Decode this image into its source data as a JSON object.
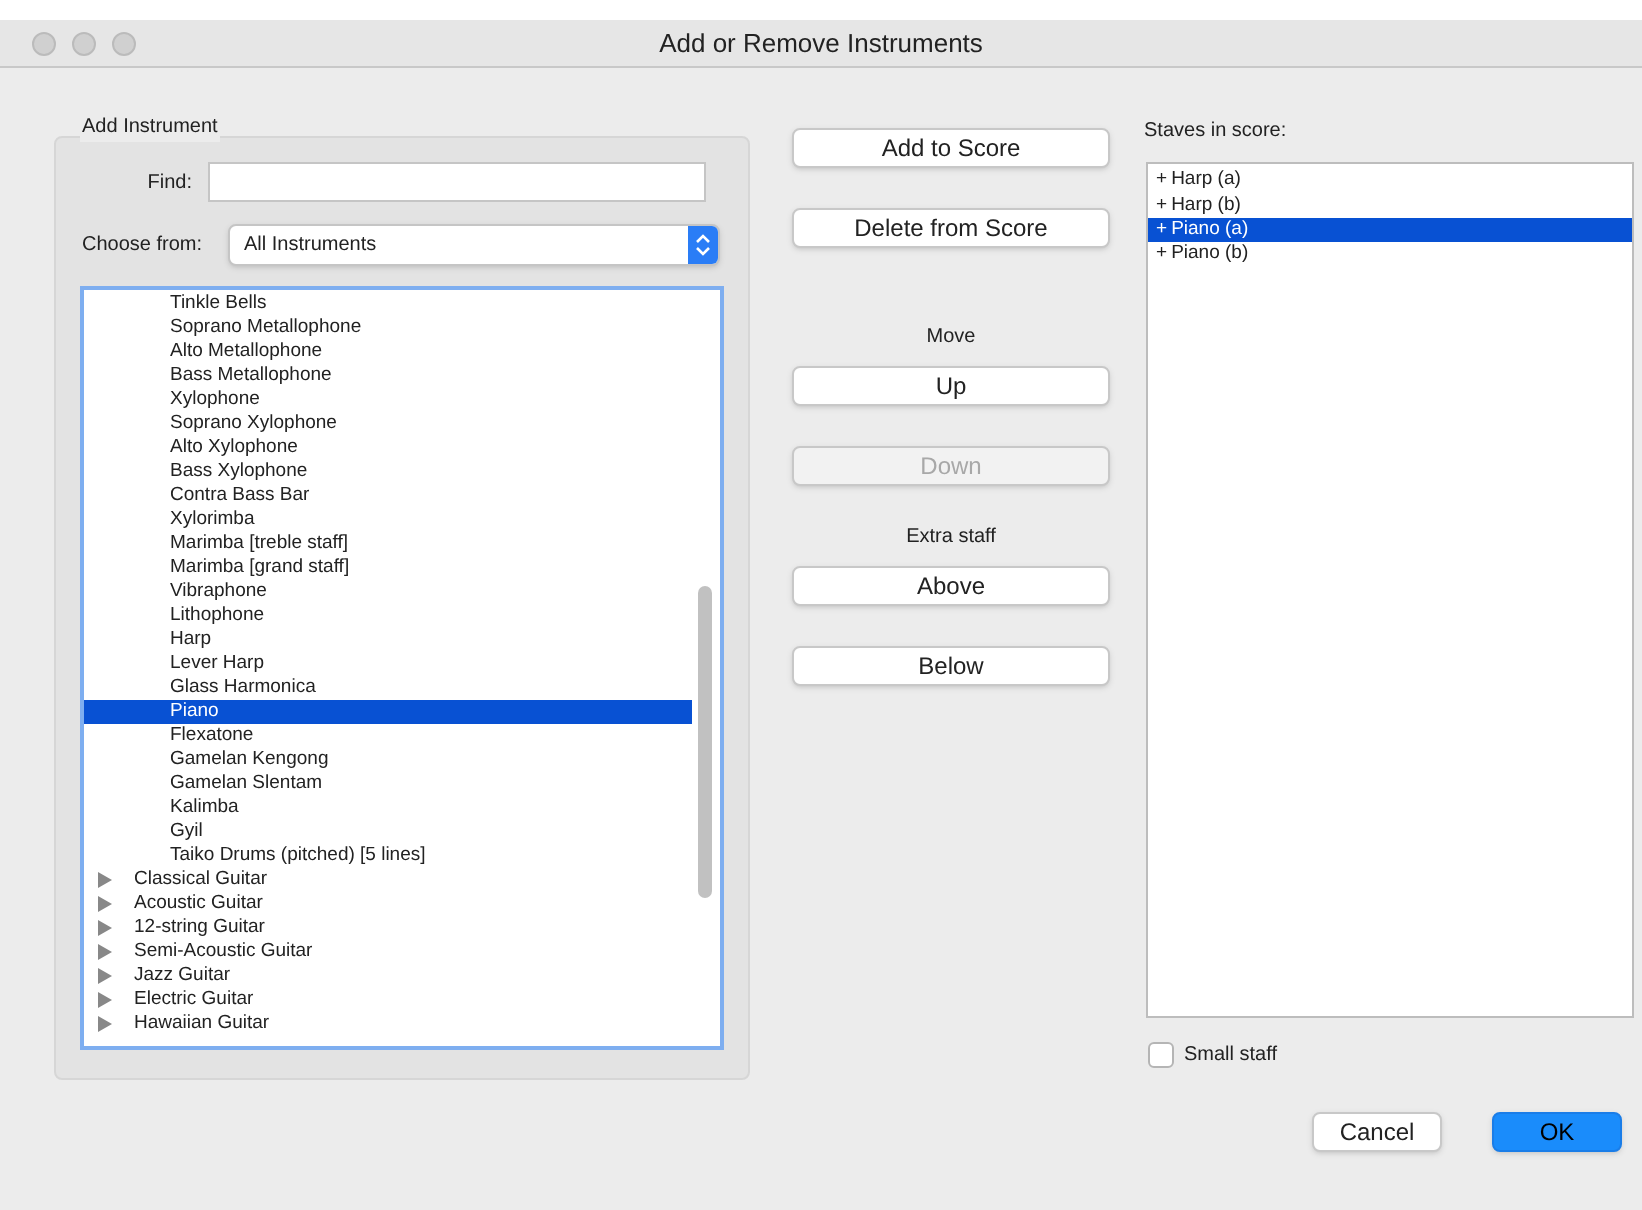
{
  "window": {
    "title": "Add or Remove Instruments"
  },
  "add_instrument": {
    "title": "Add Instrument",
    "find_label": "Find:",
    "choose_label": "Choose from:",
    "choose_value": "All Instruments",
    "items": [
      {
        "kind": "instrument",
        "label": "Tinkle Bells",
        "selected": false
      },
      {
        "kind": "instrument",
        "label": "Soprano Metallophone",
        "selected": false
      },
      {
        "kind": "instrument",
        "label": "Alto Metallophone",
        "selected": false
      },
      {
        "kind": "instrument",
        "label": "Bass Metallophone",
        "selected": false
      },
      {
        "kind": "instrument",
        "label": "Xylophone",
        "selected": false
      },
      {
        "kind": "instrument",
        "label": "Soprano Xylophone",
        "selected": false
      },
      {
        "kind": "instrument",
        "label": "Alto Xylophone",
        "selected": false
      },
      {
        "kind": "instrument",
        "label": "Bass Xylophone",
        "selected": false
      },
      {
        "kind": "instrument",
        "label": "Contra Bass Bar",
        "selected": false
      },
      {
        "kind": "instrument",
        "label": "Xylorimba",
        "selected": false
      },
      {
        "kind": "instrument",
        "label": "Marimba [treble staff]",
        "selected": false
      },
      {
        "kind": "instrument",
        "label": "Marimba [grand staff]",
        "selected": false
      },
      {
        "kind": "instrument",
        "label": "Vibraphone",
        "selected": false
      },
      {
        "kind": "instrument",
        "label": "Lithophone",
        "selected": false
      },
      {
        "kind": "instrument",
        "label": "Harp",
        "selected": false
      },
      {
        "kind": "instrument",
        "label": "Lever Harp",
        "selected": false
      },
      {
        "kind": "instrument",
        "label": "Glass Harmonica",
        "selected": false
      },
      {
        "kind": "instrument",
        "label": "Piano",
        "selected": true
      },
      {
        "kind": "instrument",
        "label": "Flexatone",
        "selected": false
      },
      {
        "kind": "instrument",
        "label": "Gamelan Kengong",
        "selected": false
      },
      {
        "kind": "instrument",
        "label": "Gamelan Slentam",
        "selected": false
      },
      {
        "kind": "instrument",
        "label": "Kalimba",
        "selected": false
      },
      {
        "kind": "instrument",
        "label": "Gyil",
        "selected": false
      },
      {
        "kind": "instrument",
        "label": "Taiko Drums (pitched) [5 lines]",
        "selected": false
      },
      {
        "kind": "group",
        "label": "Classical Guitar",
        "expanded": false,
        "selected": false
      },
      {
        "kind": "group",
        "label": "Acoustic Guitar",
        "expanded": false,
        "selected": false
      },
      {
        "kind": "group",
        "label": "12-string Guitar",
        "expanded": false,
        "selected": false
      },
      {
        "kind": "group",
        "label": "Semi-Acoustic Guitar",
        "expanded": false,
        "selected": false
      },
      {
        "kind": "group",
        "label": "Jazz Guitar",
        "expanded": false,
        "selected": false
      },
      {
        "kind": "group",
        "label": "Electric Guitar",
        "expanded": false,
        "selected": false
      },
      {
        "kind": "group",
        "label": "Hawaiian Guitar",
        "expanded": false,
        "selected": false
      }
    ]
  },
  "actions": [
    {
      "kind": "button",
      "label": "Add to Score",
      "disabled": false
    },
    {
      "kind": "button",
      "label": "Delete from Score",
      "disabled": false
    },
    {
      "kind": "heading",
      "label": "Move"
    },
    {
      "kind": "button",
      "label": "Up",
      "disabled": false
    },
    {
      "kind": "button",
      "label": "Down",
      "disabled": true
    },
    {
      "kind": "heading",
      "label": "Extra staff"
    },
    {
      "kind": "button",
      "label": "Above",
      "disabled": false
    },
    {
      "kind": "button",
      "label": "Below",
      "disabled": false
    }
  ],
  "staves": {
    "label": "Staves in score:",
    "items": [
      {
        "marker": "+",
        "label": "Harp (a)",
        "selected": false
      },
      {
        "marker": "+",
        "label": "Harp (b)",
        "selected": false
      },
      {
        "marker": "+",
        "label": "Piano (a)",
        "selected": true
      },
      {
        "marker": "+",
        "label": "Piano (b)",
        "selected": false
      }
    ]
  },
  "small_staff": {
    "label": "Small staff",
    "checked": false
  },
  "buttons": [
    {
      "label": "Cancel",
      "default": false
    },
    {
      "label": "OK",
      "default": true
    }
  ]
}
